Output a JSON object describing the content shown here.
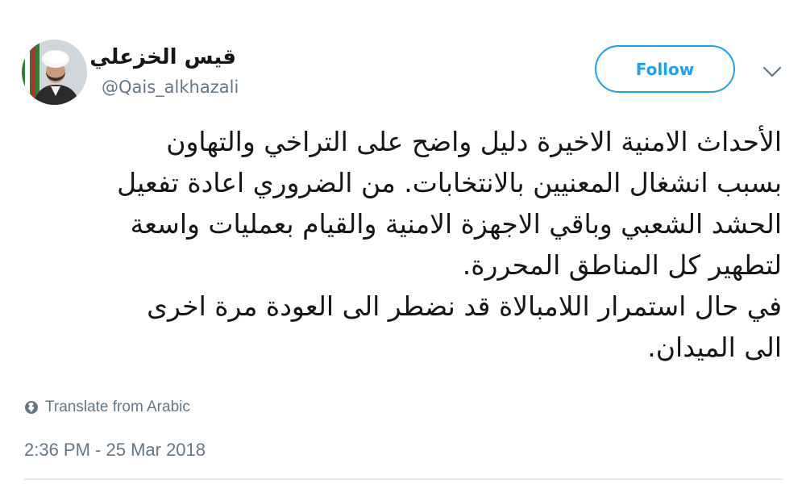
{
  "tweet": {
    "author": {
      "display_name": "قيس الخزعلي",
      "handle": "@Qais_alkhazali",
      "avatar": "avatar-photo"
    },
    "follow_label": "Follow",
    "menu_icon": "chevron-down-icon",
    "text_lines": [
      "الأحداث الامنية الاخيرة دليل واضح على التراخي والتهاون",
      "بسبب انشغال المعنيين بالانتخابات. من الضروري اعادة تفعيل",
      "الحشد الشعبي وباقي الاجهزة الامنية والقيام بعمليات واسعة",
      "لتطهير كل المناطق المحررة.",
      "في حال استمرار اللامبالاة قد نضطر الى العودة مرة اخرى",
      "الى الميدان."
    ],
    "translate_label": "Translate from Arabic",
    "translate_icon": "globe-icon",
    "timestamp": "2:36 PM - 25 Mar 2018"
  },
  "colors": {
    "accent": "#1da1f2",
    "text": "#14171a",
    "secondary_text": "#657786",
    "divider": "#e6ecf0"
  }
}
